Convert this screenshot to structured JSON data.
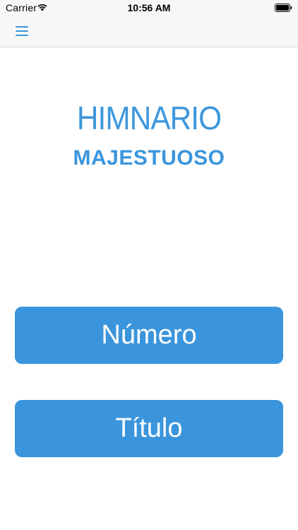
{
  "status_bar": {
    "carrier": "Carrier",
    "time": "10:56 AM",
    "wifi_icon": "wifi-icon",
    "battery_icon": "battery-icon"
  },
  "nav": {
    "menu_icon": "hamburger-menu-icon"
  },
  "header": {
    "title": "HIMNARIO",
    "subtitle": "MAJESTUOSO"
  },
  "buttons": {
    "numero_label": "Número",
    "titulo_label": "Título"
  },
  "colors": {
    "accent": "#3a95dc",
    "nav_background": "#f7f7f7",
    "background": "#ffffff"
  }
}
